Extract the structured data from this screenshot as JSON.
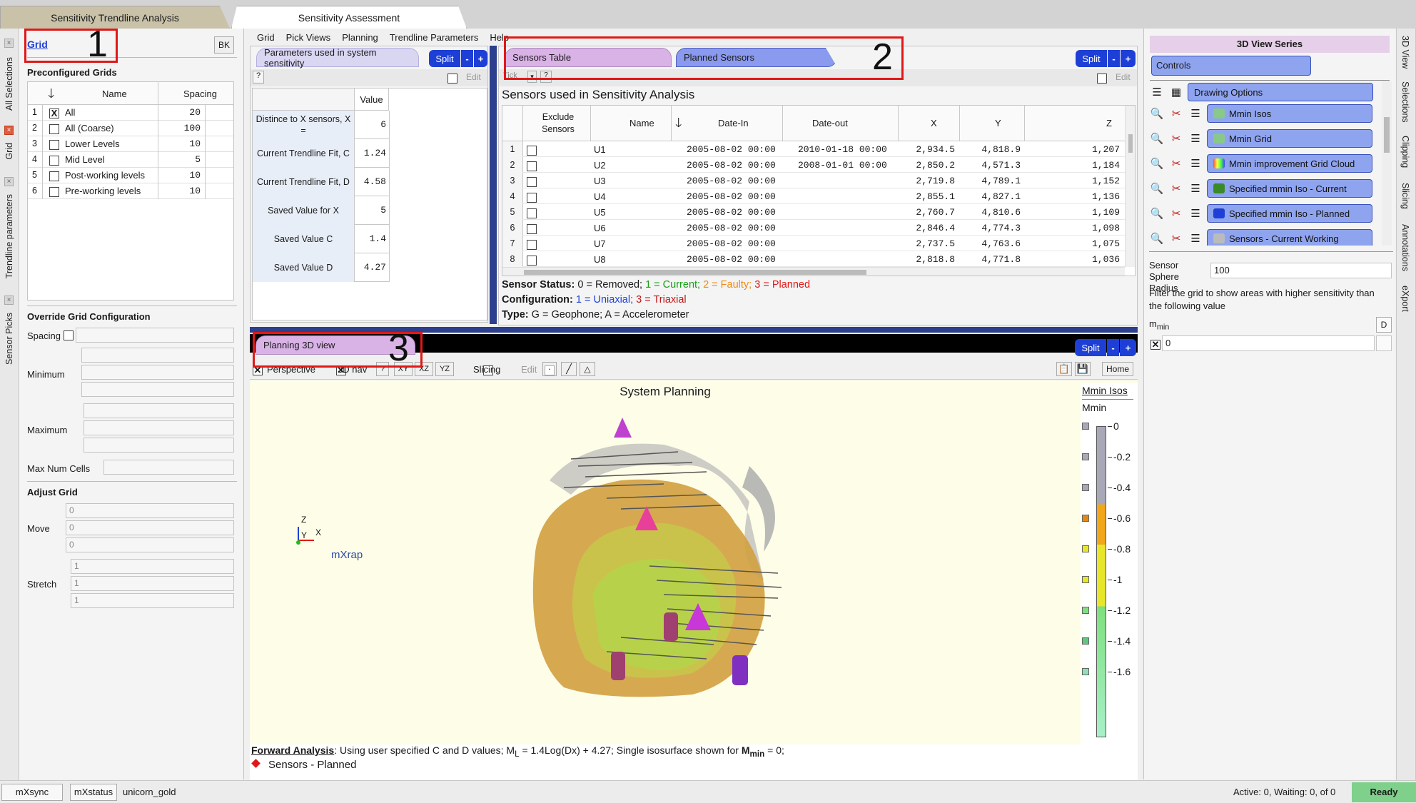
{
  "tabs": {
    "tab1": "Sensitivity Trendline Analysis",
    "tab2": "Sensitivity Assessment"
  },
  "left_vtabs": [
    "All Selections",
    "Grid",
    "Trendline parameters",
    "Sensor Picks"
  ],
  "right_vtabs": [
    "3D View",
    "Selections",
    "Clipping",
    "Slicing",
    "Annotations",
    "eXport"
  ],
  "menu": [
    "Grid",
    "Pick Views",
    "Planning",
    "Trendline Parameters",
    "Help"
  ],
  "grid_panel": {
    "title": "Grid",
    "bk": "BK",
    "preconfig_label": "Preconfigured Grids",
    "col_name": "Name",
    "col_spacing": "Spacing",
    "rows": [
      {
        "n": "1",
        "checked": "X",
        "name": "All",
        "spacing": "20"
      },
      {
        "n": "2",
        "checked": "",
        "name": "All (Coarse)",
        "spacing": "100"
      },
      {
        "n": "3",
        "checked": "",
        "name": "Lower Levels",
        "spacing": "10"
      },
      {
        "n": "4",
        "checked": "",
        "name": "Mid Level",
        "spacing": "5"
      },
      {
        "n": "5",
        "checked": "",
        "name": "Post-working levels",
        "spacing": "10"
      },
      {
        "n": "6",
        "checked": "",
        "name": "Pre-working levels",
        "spacing": "10"
      }
    ],
    "override_label": "Override Grid Configuration",
    "spacing": "Spacing",
    "minimum": "Minimum",
    "maximum": "Maximum",
    "max_num_cells": "Max Num Cells",
    "adjust_label": "Adjust Grid",
    "move": "Move",
    "stretch": "Stretch",
    "move_vals": [
      "0",
      "0",
      "0"
    ],
    "stretch_vals": [
      "1",
      "1",
      "1"
    ]
  },
  "params_panel": {
    "tab": "Parameters used in system sensitivity",
    "split": "Split",
    "help": "?",
    "edit": "Edit",
    "value_header": "Value",
    "rows": [
      {
        "label": "Distince to X sensors, X =",
        "value": "6"
      },
      {
        "label": "Current Trendline Fit, C",
        "value": "1.24"
      },
      {
        "label": "Current Trendline Fit, D",
        "value": "4.58"
      },
      {
        "label": "Saved Value for X",
        "value": "5"
      },
      {
        "label": "Saved Value C",
        "value": "1.4"
      },
      {
        "label": "Saved Value D",
        "value": "4.27"
      }
    ]
  },
  "sensors_panel": {
    "tab1": "Sensors Table",
    "tab2": "Planned Sensors",
    "split": "Split",
    "tick": "Tick",
    "help": "?",
    "edit": "Edit",
    "title": "Sensors used in Sensitivity Analysis",
    "headers": {
      "exclude": "Exclude Sensors",
      "name": "Name",
      "date_in": "Date-In",
      "date_out": "Date-out",
      "x": "X",
      "y": "Y",
      "z": "Z"
    },
    "rows": [
      {
        "n": "1",
        "name": "U1",
        "din": "2005-08-02 00:00",
        "dout": "2010-01-18 00:00",
        "x": "2,934.5",
        "y": "4,818.9",
        "z": "1,207"
      },
      {
        "n": "2",
        "name": "U2",
        "din": "2005-08-02 00:00",
        "dout": "2008-01-01 00:00",
        "x": "2,850.2",
        "y": "4,571.3",
        "z": "1,184"
      },
      {
        "n": "3",
        "name": "U3",
        "din": "2005-08-02 00:00",
        "dout": "",
        "x": "2,719.8",
        "y": "4,789.1",
        "z": "1,152"
      },
      {
        "n": "4",
        "name": "U4",
        "din": "2005-08-02 00:00",
        "dout": "",
        "x": "2,855.1",
        "y": "4,827.1",
        "z": "1,136"
      },
      {
        "n": "5",
        "name": "U5",
        "din": "2005-08-02 00:00",
        "dout": "",
        "x": "2,760.7",
        "y": "4,810.6",
        "z": "1,109"
      },
      {
        "n": "6",
        "name": "U6",
        "din": "2005-08-02 00:00",
        "dout": "",
        "x": "2,846.4",
        "y": "4,774.3",
        "z": "1,098"
      },
      {
        "n": "7",
        "name": "U7",
        "din": "2005-08-02 00:00",
        "dout": "",
        "x": "2,737.5",
        "y": "4,763.6",
        "z": "1,075"
      },
      {
        "n": "8",
        "name": "U8",
        "din": "2005-08-02 00:00",
        "dout": "",
        "x": "2,818.8",
        "y": "4,771.8",
        "z": "1,036"
      }
    ],
    "status_label": "Sensor Status:",
    "status_removed": "0 = Removed;",
    "status_current": "1 = Current;",
    "status_faulty": "2 = Faulty;",
    "status_planned": "3 = Planned",
    "config_label": "Configuration:",
    "config_uni": "1 = Uniaxial;",
    "config_tri": "3 = Triaxial",
    "type_label": "Type:",
    "type_text": "G = Geophone; A = Accelerometer"
  },
  "view3d": {
    "tab": "Planning 3D view",
    "split": "Split",
    "perspective": "Perspective",
    "nav": "3D nav",
    "help": "?",
    "xy": "XY",
    "xz": "XZ",
    "yz": "YZ",
    "slicing": "Slicing",
    "edit": "Edit",
    "home": "Home",
    "title": "System Planning",
    "legend_title": "Mmin Isos",
    "legend_sub": "Mmin",
    "legend_ticks": [
      "0",
      "-0.2",
      "-0.4",
      "-0.6",
      "-0.8",
      "-1",
      "-1.2",
      "-1.4",
      "-1.6"
    ],
    "axis_z": "Z",
    "axis_y": "Y",
    "axis_x": "X",
    "logo": "mXrap",
    "footer_bold": "Forward Analysis",
    "footer_text": ": Using user specified C and D values; M",
    "footer_sub": "L",
    "footer_eq": " = 1.4Log(Dx) + 4.27; Single isosurface shown for ",
    "footer_m": "M",
    "footer_msub": "min",
    "footer_end": " = 0;",
    "sensors_planned": "Sensors - Planned"
  },
  "series_panel": {
    "title": "3D View Series",
    "controls": "Controls",
    "drawing_options": "Drawing Options",
    "items": [
      "Mmin Isos",
      "Mmin Grid",
      "Mmin improvement Grid Cloud",
      "Specified mmin Iso - Current",
      "Specified mmin Iso - Planned",
      "Sensors - Current Working"
    ],
    "radius_label": "Sensor Sphere Radius",
    "radius_value": "100",
    "filter_text": "Filter the grid to show areas with higher sensitivity than the following value",
    "mmin_label": "m",
    "mmin_sub": "min",
    "d_btn": "D",
    "mmin_value": "0"
  },
  "annotations": {
    "n1": "1",
    "n2": "2",
    "n3": "3"
  },
  "status": {
    "mxsync": "mXsync",
    "mxstatus": "mXstatus",
    "user": "unicorn_gold",
    "active": "Active: 0, Waiting: 0, of",
    "of_count": "0",
    "ready": "Ready"
  },
  "colors": {
    "blue": "#1e3fd6",
    "pink_tab": "#d9b2e6",
    "series_btn": "#8fa4ef",
    "ready": "#7fd08b",
    "legend_gray": "#a8a8b8",
    "legend_orange": "#f2a61a",
    "legend_yellow": "#e8e62a",
    "legend_green": "#7ee07e"
  }
}
